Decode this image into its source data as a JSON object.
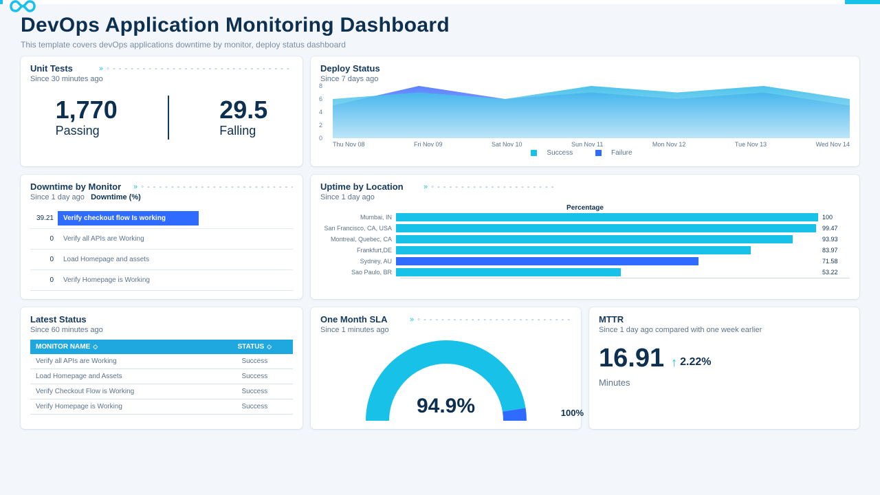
{
  "header": {
    "title": "DevOps Application Monitoring Dashboard",
    "subtitle": "This template covers devOps applications downtime by monitor, deploy status dashboard"
  },
  "unit_tests": {
    "title": "Unit Tests",
    "since": "Since 30 minutes ago",
    "passing_value": "1,770",
    "passing_label": "Passing",
    "failing_value": "29.5",
    "failing_label": "Falling"
  },
  "deploy_status": {
    "title": "Deploy Status",
    "since": "Since 7 days ago",
    "legend_success": "Success",
    "legend_failure": "Failure"
  },
  "downtime": {
    "title": "Downtime by Monitor",
    "since": "Since 1 day ago",
    "metric": "Downtime (%)"
  },
  "uptime": {
    "title": "Uptime by Location",
    "since": "Since 1 day ago",
    "axis": "Percentage"
  },
  "latest": {
    "title": "Latest Status",
    "since": "Since 60 minutes ago",
    "col_monitor": "MONITOR NAME",
    "col_status": "STATUS",
    "rows": [
      {
        "name": "Verify all APIs are Working",
        "status": "Success"
      },
      {
        "name": "Load Homepage and Assets",
        "status": "Success"
      },
      {
        "name": "Verify Checkout Flow is Working",
        "status": "Success"
      },
      {
        "name": "Verify Homepage is Working",
        "status": "Success"
      }
    ]
  },
  "sla": {
    "title": "One Month SLA",
    "since": "Since 1 minutes ago",
    "value": "94.9%",
    "max": "100%"
  },
  "mttr": {
    "title": "MTTR",
    "since": "Since 1 day ago compared with one week earlier",
    "value": "16.91",
    "delta": "2.22%",
    "unit": "Minutes"
  },
  "chart_data": [
    {
      "type": "area",
      "name": "Deploy Status",
      "categories": [
        "Thu Nov 08",
        "Fri Nov 09",
        "Sat Nov 10",
        "Sun Nov 11",
        "Mon Nov 12",
        "Tue Nov 13",
        "Wed Nov 14"
      ],
      "series": [
        {
          "name": "Success",
          "values": [
            6,
            7,
            6,
            8,
            7,
            8,
            6
          ],
          "color": "#17c1e8"
        },
        {
          "name": "Failure",
          "values": [
            5,
            8,
            6,
            7,
            6,
            7,
            5
          ],
          "color": "#2f6bff"
        }
      ],
      "ylim": [
        0,
        8
      ],
      "yticks": [
        0,
        2,
        4,
        6,
        8
      ]
    },
    {
      "type": "bar",
      "name": "Downtime by Monitor",
      "orientation": "horizontal",
      "xlabel": "Downtime (%)",
      "categories": [
        "Verify checkout flow Is working",
        "Verify all APIs are Working",
        "Load Homepage and assets",
        "Verify Homepage is Working"
      ],
      "values": [
        39.21,
        0,
        0,
        0
      ],
      "xlim": [
        0,
        100
      ]
    },
    {
      "type": "bar",
      "name": "Uptime by Location",
      "orientation": "horizontal",
      "title": "Percentage",
      "categories": [
        "Mumbai, IN",
        "San Francisco, CA, USA",
        "Montreal, Quebec, CA",
        "Frankfurt,DE",
        "Sydney, AU",
        "Sao Paulo, BR"
      ],
      "values": [
        100,
        99.47,
        93.93,
        83.97,
        71.58,
        53.22
      ],
      "colors": [
        "#17c1e8",
        "#17c1e8",
        "#17c1e8",
        "#17c1e8",
        "#2f6bff",
        "#17c1e8"
      ],
      "xlim": [
        0,
        100
      ]
    },
    {
      "type": "pie",
      "name": "One Month SLA",
      "subtype": "gauge",
      "value": 94.9,
      "max": 100,
      "colors": {
        "value": "#17c1e8",
        "remainder": "#2f6bff"
      }
    }
  ]
}
